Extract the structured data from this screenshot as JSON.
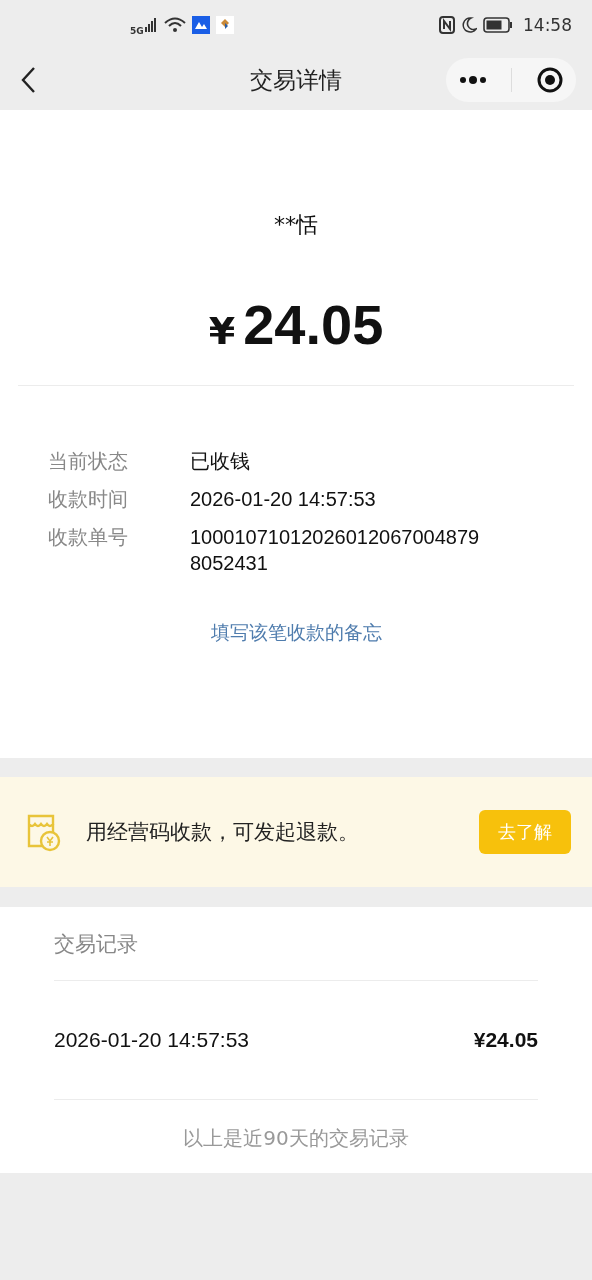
{
  "status_bar": {
    "network": "5G",
    "time": "14:58"
  },
  "nav": {
    "title": "交易详情"
  },
  "payer": "**恬",
  "amount": {
    "currency": "¥",
    "value": "24.05"
  },
  "details": [
    {
      "label": "当前状态",
      "value": "已收钱"
    },
    {
      "label": "收款时间",
      "value": "2026-01-20 14:57:53"
    },
    {
      "label": "收款单号",
      "value": "10001071012026012067004879\n8052431"
    }
  ],
  "memo_link": "填写该笔收款的备忘",
  "banner": {
    "text": "用经营码收款，可发起退款。",
    "button": "去了解"
  },
  "records": {
    "title": "交易记录",
    "rows": [
      {
        "time": "2026-01-20 14:57:53",
        "amount": "¥24.05"
      }
    ],
    "footer": "以上是近90天的交易记录"
  }
}
